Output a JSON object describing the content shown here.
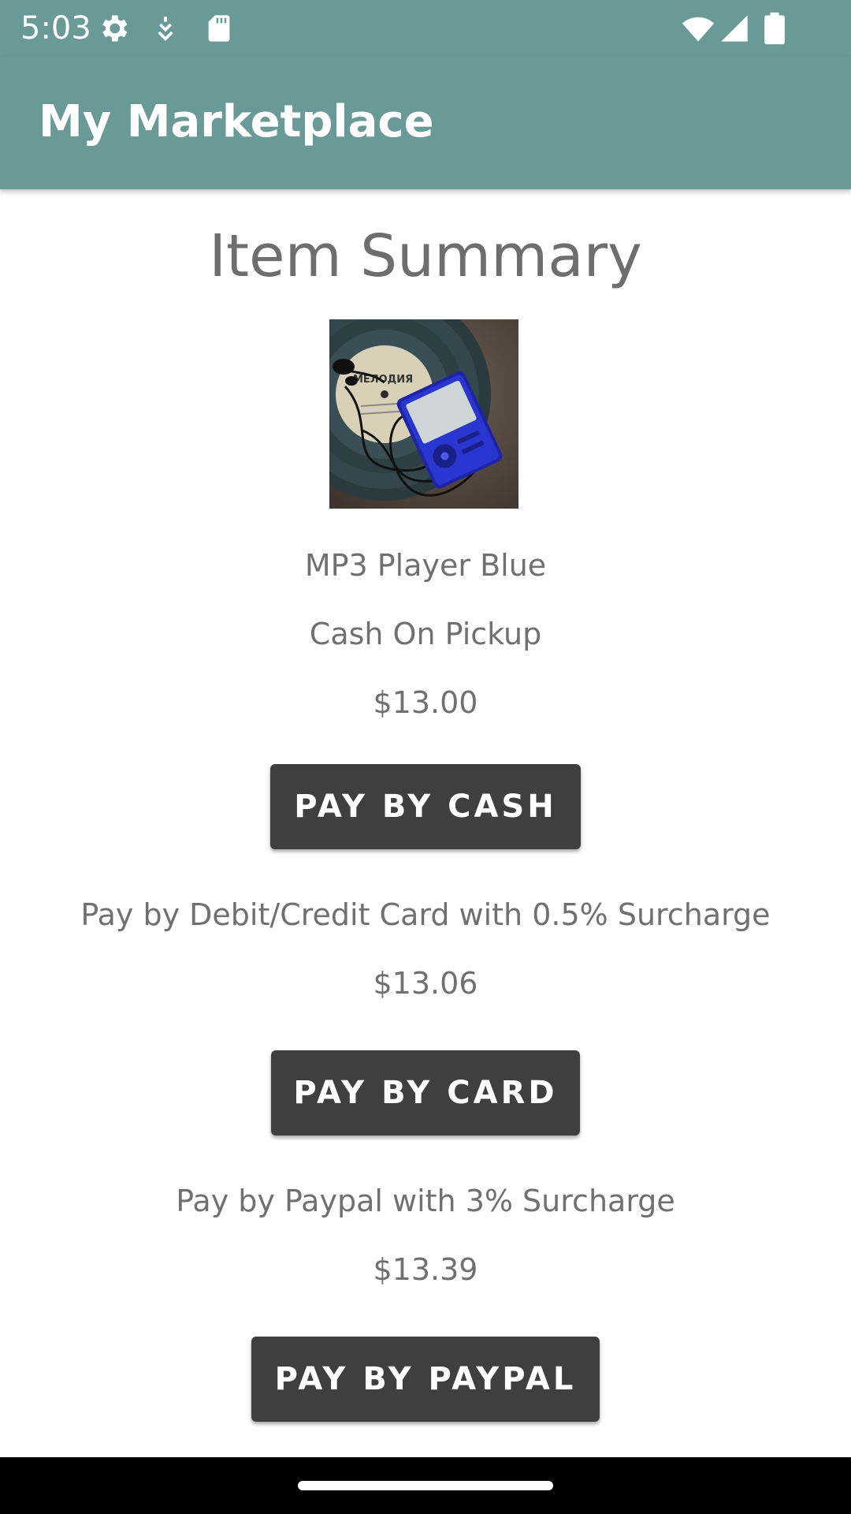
{
  "status_bar": {
    "time": "5:03",
    "icons": [
      "settings-icon",
      "download-icon",
      "sd-card-icon",
      "wifi-icon",
      "signal-icon",
      "battery-icon"
    ]
  },
  "app_bar": {
    "title": "My Marketplace"
  },
  "summary": {
    "title": "Item Summary",
    "item_name": "MP3 Player Blue",
    "pickup_method": "Cash On Pickup",
    "cash_price": "$13.00",
    "cash_button": "PAY BY CASH",
    "card_description": "Pay by Debit/Credit Card with 0.5% Surcharge",
    "card_price": "$13.06",
    "card_button": "PAY BY CARD",
    "paypal_description": "Pay by Paypal with 3% Surcharge",
    "paypal_price": "$13.39",
    "paypal_button": "PAY BY PAYPAL",
    "record_label_text": "МЕЛОДИЯ"
  },
  "colors": {
    "primary": "#6a9a98",
    "button": "#3f3f3f",
    "text": "#707070"
  }
}
